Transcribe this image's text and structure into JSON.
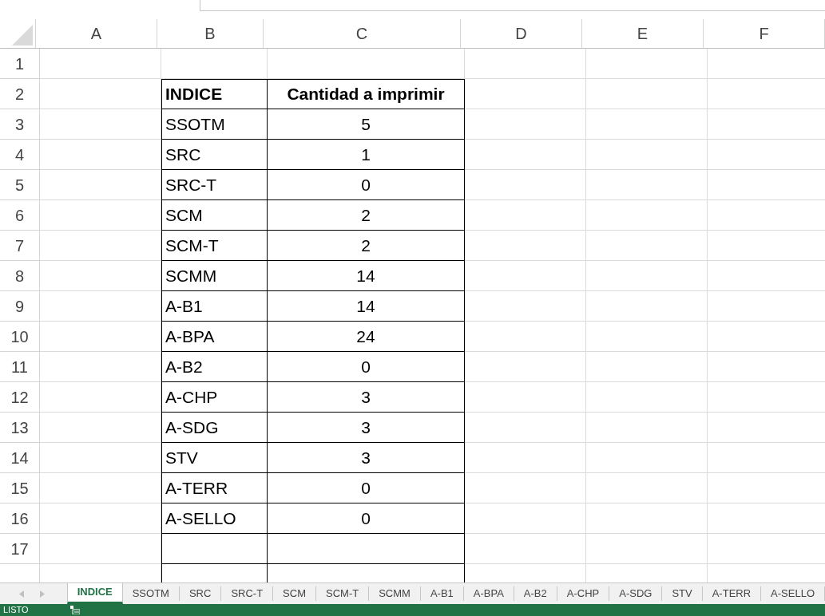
{
  "column_headers": [
    "A",
    "B",
    "C",
    "D",
    "E",
    "F"
  ],
  "row_numbers": [
    "1",
    "2",
    "3",
    "4",
    "5",
    "6",
    "7",
    "8",
    "9",
    "10",
    "11",
    "12",
    "13",
    "14",
    "15",
    "16",
    "17"
  ],
  "table": {
    "columns": [
      "INDICE",
      "Cantidad a imprimir"
    ],
    "rows": [
      [
        "SSOTM",
        "5"
      ],
      [
        "SRC",
        "1"
      ],
      [
        "SRC-T",
        "0"
      ],
      [
        "SCM",
        "2"
      ],
      [
        "SCM-T",
        "2"
      ],
      [
        "SCMM",
        "14"
      ],
      [
        "A-B1",
        "14"
      ],
      [
        "A-BPA",
        "24"
      ],
      [
        "A-B2",
        "0"
      ],
      [
        "A-CHP",
        "3"
      ],
      [
        "A-SDG",
        "3"
      ],
      [
        "STV",
        "3"
      ],
      [
        "A-TERR",
        "0"
      ],
      [
        "A-SELLO",
        "0"
      ]
    ]
  },
  "sheet_tabs": [
    {
      "label": "INDICE",
      "selected": true
    },
    {
      "label": "SSOTM",
      "selected": false
    },
    {
      "label": "SRC",
      "selected": false
    },
    {
      "label": "SRC-T",
      "selected": false
    },
    {
      "label": "SCM",
      "selected": false
    },
    {
      "label": "SCM-T",
      "selected": false
    },
    {
      "label": "SCMM",
      "selected": false
    },
    {
      "label": "A-B1",
      "selected": false
    },
    {
      "label": "A-BPA",
      "selected": false
    },
    {
      "label": "A-B2",
      "selected": false
    },
    {
      "label": "A-CHP",
      "selected": false
    },
    {
      "label": "A-SDG",
      "selected": false
    },
    {
      "label": "STV",
      "selected": false
    },
    {
      "label": "A-TERR",
      "selected": false
    },
    {
      "label": "A-SELLO",
      "selected": false
    }
  ],
  "status_bar": {
    "text": "LISTO"
  }
}
